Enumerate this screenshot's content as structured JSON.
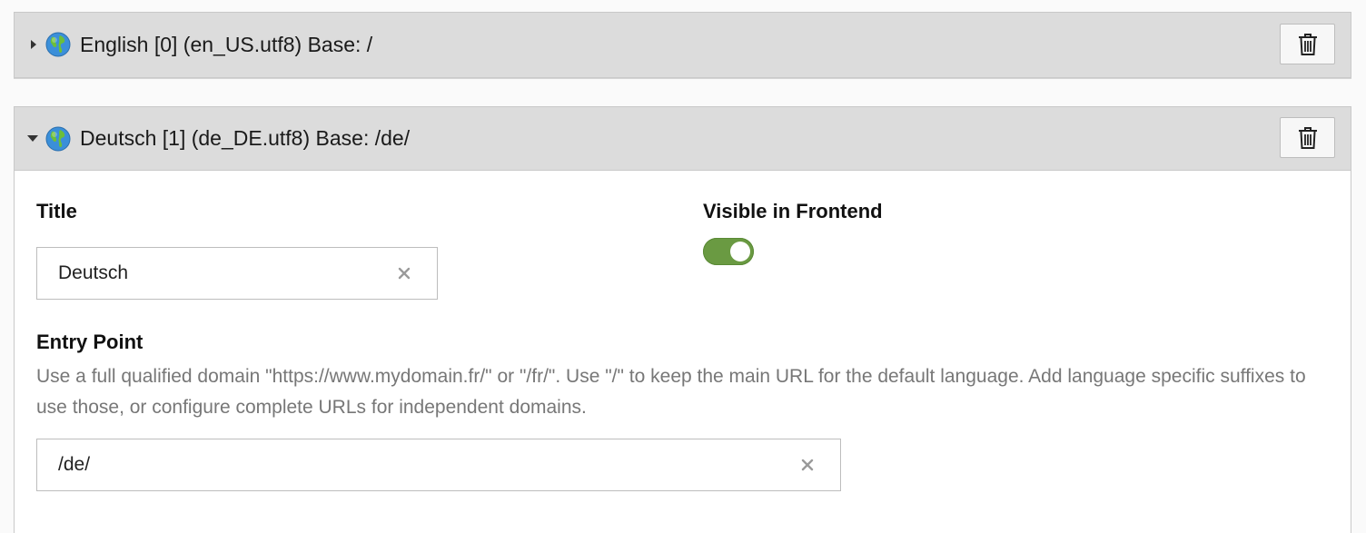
{
  "languages": [
    {
      "header": "English [0] (en_US.utf8) Base: /",
      "expanded": false
    },
    {
      "header": "Deutsch [1] (de_DE.utf8) Base: /de/",
      "expanded": true
    }
  ],
  "form": {
    "title_label": "Title",
    "title_value": "Deutsch",
    "visible_label": "Visible in Frontend",
    "visible_on": true,
    "entry_label": "Entry Point",
    "entry_description": "Use a full qualified domain \"https://www.mydomain.fr/\" or \"/fr/\". Use \"/\" to keep the main URL for the default language. Add language specific suffixes to use those, or configure complete URLs for independent domains.",
    "entry_value": "/de/"
  },
  "icons": {
    "expand": "caret-right-icon",
    "collapse": "caret-down-icon",
    "language": "globe-icon",
    "delete": "trash-icon",
    "clear": "close-icon"
  },
  "colors": {
    "header_bg": "#dcdcdc",
    "toggle_on": "#6a9a42",
    "description": "#777777"
  }
}
